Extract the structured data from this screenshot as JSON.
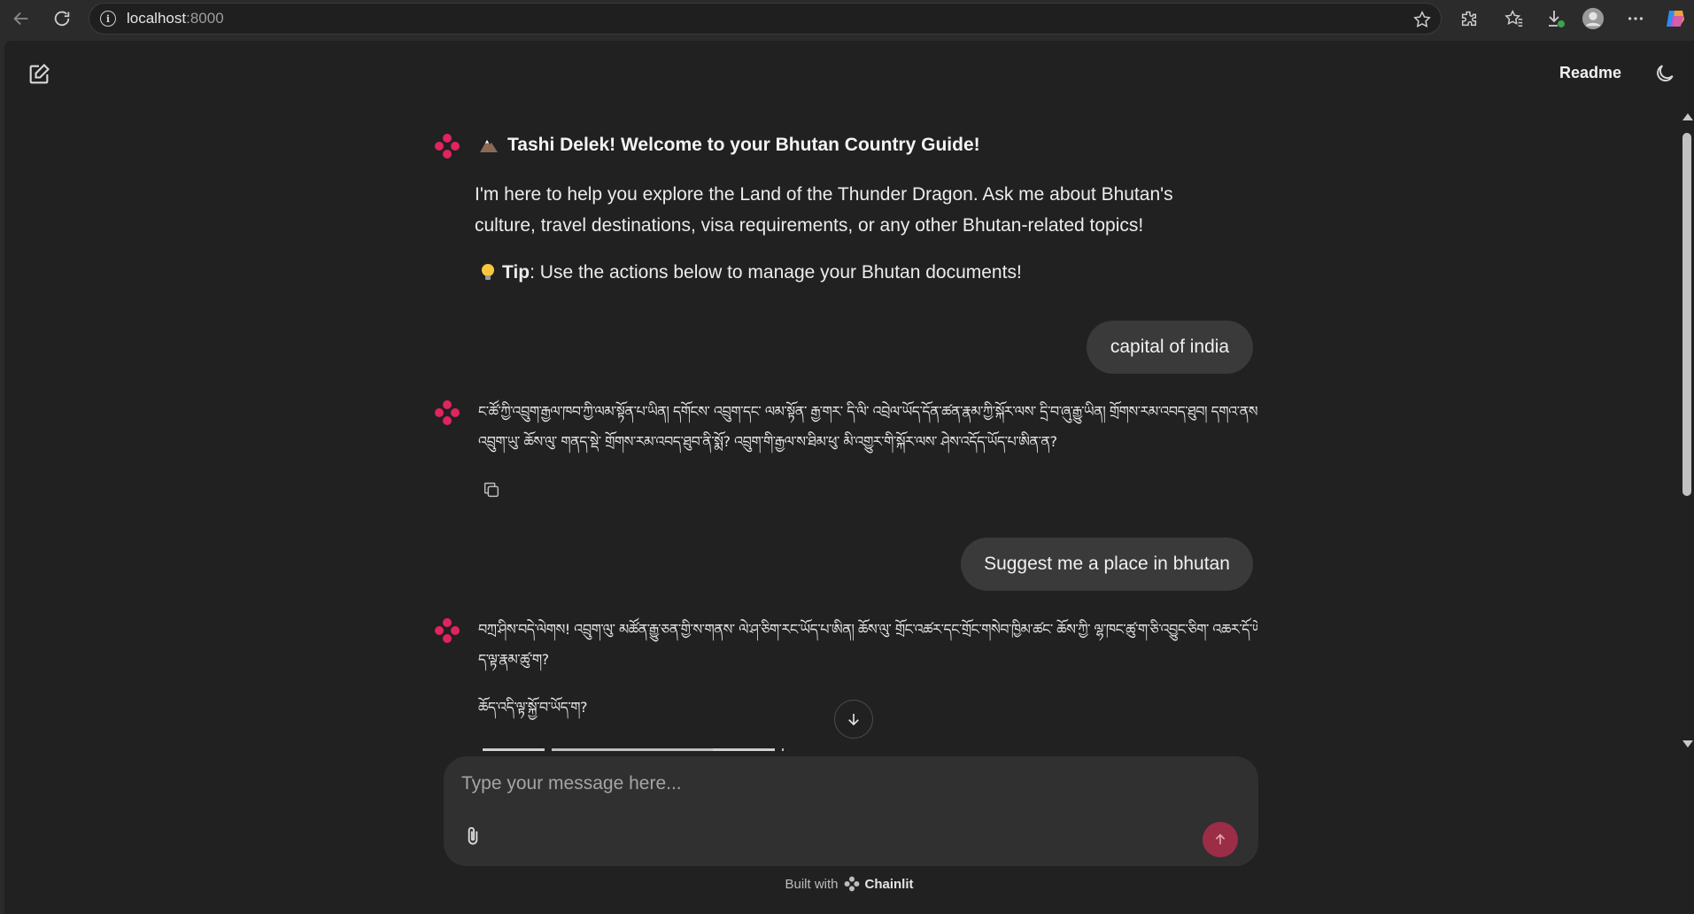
{
  "browser": {
    "url_host": "localhost",
    "url_port": ":8000"
  },
  "header": {
    "readme_label": "Readme"
  },
  "welcome": {
    "title": "Tashi Delek! Welcome to your Bhutan Country Guide!",
    "body_line1": "I'm here to help you explore the Land of the Thunder Dragon. Ask me about Bhutan's",
    "body_line2": "culture, travel destinations, visa requirements, or any other Bhutan-related topics!",
    "tip_label": "Tip",
    "tip_text": ": Use the actions below to manage your Bhutan documents!"
  },
  "messages": [
    {
      "role": "user",
      "text": "capital of india"
    },
    {
      "role": "assistant",
      "line1": "ང་ཚོ་ཀྱི་འབྲུག་རྒྱལ་ཁབ་ཀྱི་ལམ་སྟོན་པ་ཡིན། དགོངས་ འབྲུག་དང་ ལམ་སྟོན་ རྒྱ་གར་ དི་ལི་ འབྲེལ་ཡོད་དོན་ཚན་རྣམ་ཀྱི་སྐོར་ལས་ དྲི་བ་ཞུ་རྒྱུ་ཡིན། གྲོགས་རམ་འབད་ཐུབ། དགའ་ནས་",
      "line2": "འབྲུག་ཡུ་ ཆོས་ལུ་ གནད་སྡེ་ གྲོགས་རམ་འབད་ཐུབ་ནི་སྨོ? འབྲུག་གི་རྒྱལ་ས་ཐིམ་ཕུ་ མི་འགྱུར་གི་སྐོར་ལས་ ཤེས་འདོད་ཡོད་པ་ཨིན་ན?"
    },
    {
      "role": "user",
      "text": "Suggest me a place in bhutan"
    },
    {
      "role": "assistant",
      "line1": "བཀྲ་ཤིས་བདེ་ལེགས! འབྲུག་ལུ་ མཚོན་རྒྱུ་ཅན་གྱི་ས་གནས་ ལེ་ཤ་ཅིག་རང་ཡོད་པ་ཨིན། ཆོས་ལུ་ གྲོང་འཚར་དང་གྲོང་གསེབ་ཁྱིམ་ཚང་ ཆོས་ཀྱི་ ལྷ་ཁང་ཚུ་ག་ཅི་འབྱུང་ཅིག་ འཆར་དོ་ཡོད་པ་ཨིན་ན་",
      "line2": "ད་ལྟ་རྣམ་ཚུ་ག?",
      "line3": "ཆོད་འདི་ལྟ་སྐྱོ་བ་ཡོད་ག?"
    }
  ],
  "composer": {
    "placeholder": "Type your message here..."
  },
  "footer": {
    "built_with": "Built with",
    "brand": "Chainlit"
  },
  "colors": {
    "accent": "#e0245e",
    "send_bg": "#9c2d46",
    "bubble_bg": "#3a3a3a",
    "app_bg": "#212121"
  }
}
